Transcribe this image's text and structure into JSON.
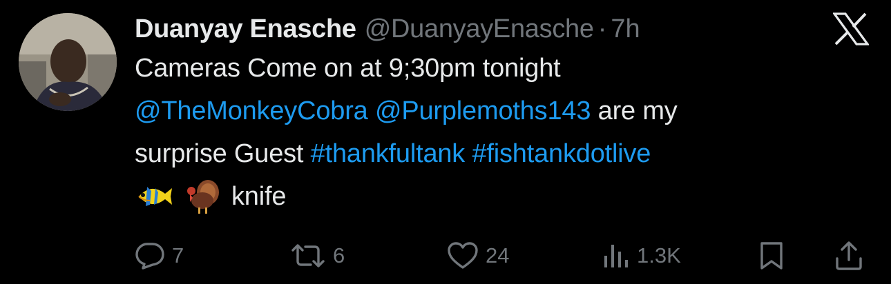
{
  "tweet": {
    "display_name": "Duanyay Enasche",
    "handle": "@DuanyayEnasche",
    "separator": "·",
    "time": "7h",
    "text_line1": "Cameras Come on at 9;30pm tonight",
    "mention1": "@TheMonkeyCobra",
    "mention2": "@Purplemoths143",
    "text_after_mentions": "are my",
    "text_line3_start": "surprise Guest",
    "hashtag1": "#thankfultank",
    "hashtag2": "#fishtankdotlive",
    "emoji1": "tropical-fish-emoji",
    "emoji2": "turkey-emoji",
    "text_last": "knife"
  },
  "actions": {
    "replies": "7",
    "reposts": "6",
    "likes": "24",
    "views": "1.3K"
  },
  "icons": {
    "logo": "x-logo-icon",
    "reply": "reply-icon",
    "repost": "repost-icon",
    "like": "heart-icon",
    "views": "views-icon",
    "bookmark": "bookmark-icon",
    "share": "share-icon"
  },
  "colors": {
    "background": "#000000",
    "text": "#e7e9ea",
    "secondary": "#71767b",
    "link": "#1d9bf0"
  }
}
